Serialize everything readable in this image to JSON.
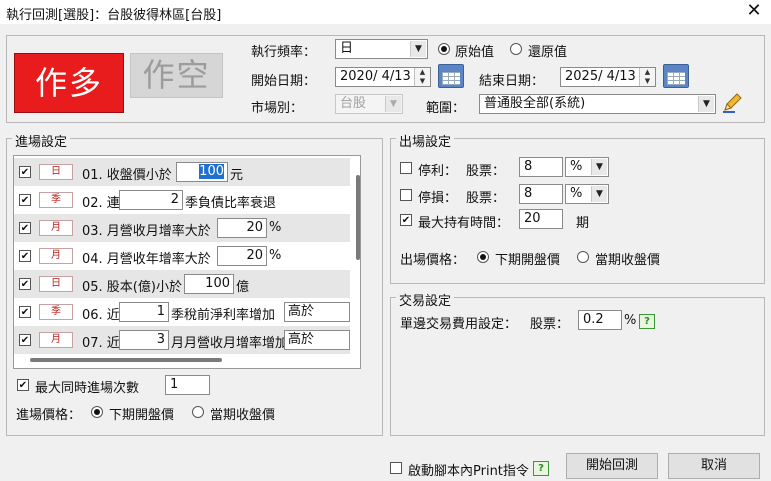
{
  "window": {
    "title": "執行回測[選股]：台股彼得林區[台股]",
    "close_symbol": "✕"
  },
  "direction": {
    "long_label": "作多",
    "short_label": "作空"
  },
  "params": {
    "frequency_label": "執行頻率：",
    "frequency_value": "日",
    "adjust_original_label": "原始值",
    "adjust_restored_label": "還原值",
    "start_label": "開始日期：",
    "start_value": "2020/ 4/13",
    "end_label": "結束日期：",
    "end_value": "2025/ 4/13",
    "market_label": "市場別：",
    "market_value": "台股",
    "scope_label": "範圍：",
    "scope_value": "普通股全部(系統)"
  },
  "entry": {
    "title": "進場設定",
    "rows": [
      {
        "checked": true,
        "freq": "日",
        "seg1": "01. 收盤價小於",
        "input1": "100",
        "seg2": "元"
      },
      {
        "checked": true,
        "freq": "季",
        "seg1": "02. 連續",
        "input1": "2",
        "seg2": "季負債比率衰退"
      },
      {
        "checked": true,
        "freq": "月",
        "seg1": "03. 月營收月增率大於",
        "input1": "20",
        "seg2": "%"
      },
      {
        "checked": true,
        "freq": "月",
        "seg1": "04. 月營收年增率大於",
        "input1": "20",
        "seg2": "%"
      },
      {
        "checked": true,
        "freq": "日",
        "seg1": "05. 股本(億)小於",
        "input1": "100",
        "seg2": "億"
      },
      {
        "checked": true,
        "freq": "季",
        "seg1": "06. 近",
        "input1": "1",
        "seg2": "季稅前淨利率增加",
        "input2": "高於"
      },
      {
        "checked": true,
        "freq": "月",
        "seg1": "07. 近",
        "input1": "3",
        "seg2": "月月營收月增率增加",
        "input2": "高於"
      }
    ],
    "max_entries_label": "最大同時進場次數",
    "max_entries_value": "1",
    "price_label": "進場價格：",
    "price_next_open": "下期開盤價",
    "price_current_close": "當期收盤價"
  },
  "exit": {
    "title": "出場設定",
    "take_profit_label": "停利：",
    "stock_label": "股票：",
    "take_profit_value": "8",
    "take_profit_unit": "%",
    "stop_loss_label": "停損：",
    "stop_loss_value": "8",
    "stop_loss_unit": "%",
    "max_hold_label": "最大持有時間：",
    "max_hold_value": "20",
    "max_hold_unit": "期",
    "price_label": "出場價格：",
    "price_next_open": "下期開盤價",
    "price_current_close": "當期收盤價"
  },
  "trade": {
    "title": "交易設定",
    "fee_label": "單邊交易費用設定：",
    "stock_label": "股票：",
    "fee_value": "0.2",
    "fee_unit": "%"
  },
  "footer": {
    "print_label": "啟動腳本內Print指令",
    "help_symbol": "?",
    "start_button": "開始回測",
    "cancel_button": "取消"
  }
}
